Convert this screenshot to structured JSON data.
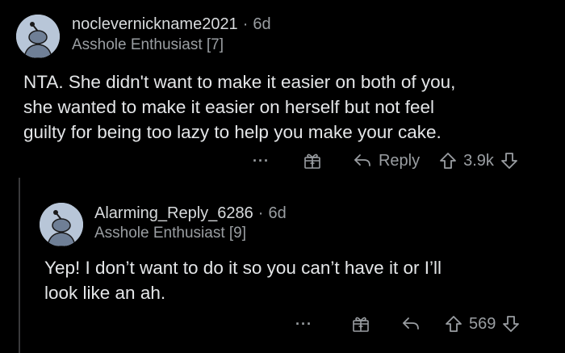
{
  "comments": [
    {
      "username": "noclevernickname2021",
      "separator": "·",
      "age": "6d",
      "flair": "Asshole Enthusiast [7]",
      "body_lines": [
        "NTA. She didn't want to make it easier on both of you,",
        "she wanted to make it easier on herself but not feel",
        "guilty for being too lazy to help you make your cake."
      ],
      "more": "···",
      "reply_label": "Reply",
      "score": "3.9k"
    },
    {
      "username": "Alarming_Reply_6286",
      "separator": "·",
      "age": "6d",
      "flair": "Asshole Enthusiast [9]",
      "body_lines": [
        "Yep! I don’t want to do it so you can’t have it or I’ll",
        "look like an ah."
      ],
      "more": "···",
      "reply_label": "",
      "score": "569"
    }
  ],
  "icons": {
    "avatar": "snoo-avatar-icon",
    "award": "gift-award-icon",
    "reply": "reply-arrow-icon",
    "upvote": "upvote-arrow-icon",
    "downvote": "downvote-arrow-icon",
    "more": "more-options-icon"
  },
  "colors": {
    "background": "#000000",
    "text": "#e4e6e8",
    "meta": "#9a9ea2",
    "avatar_bg": "#b8c6d8"
  }
}
